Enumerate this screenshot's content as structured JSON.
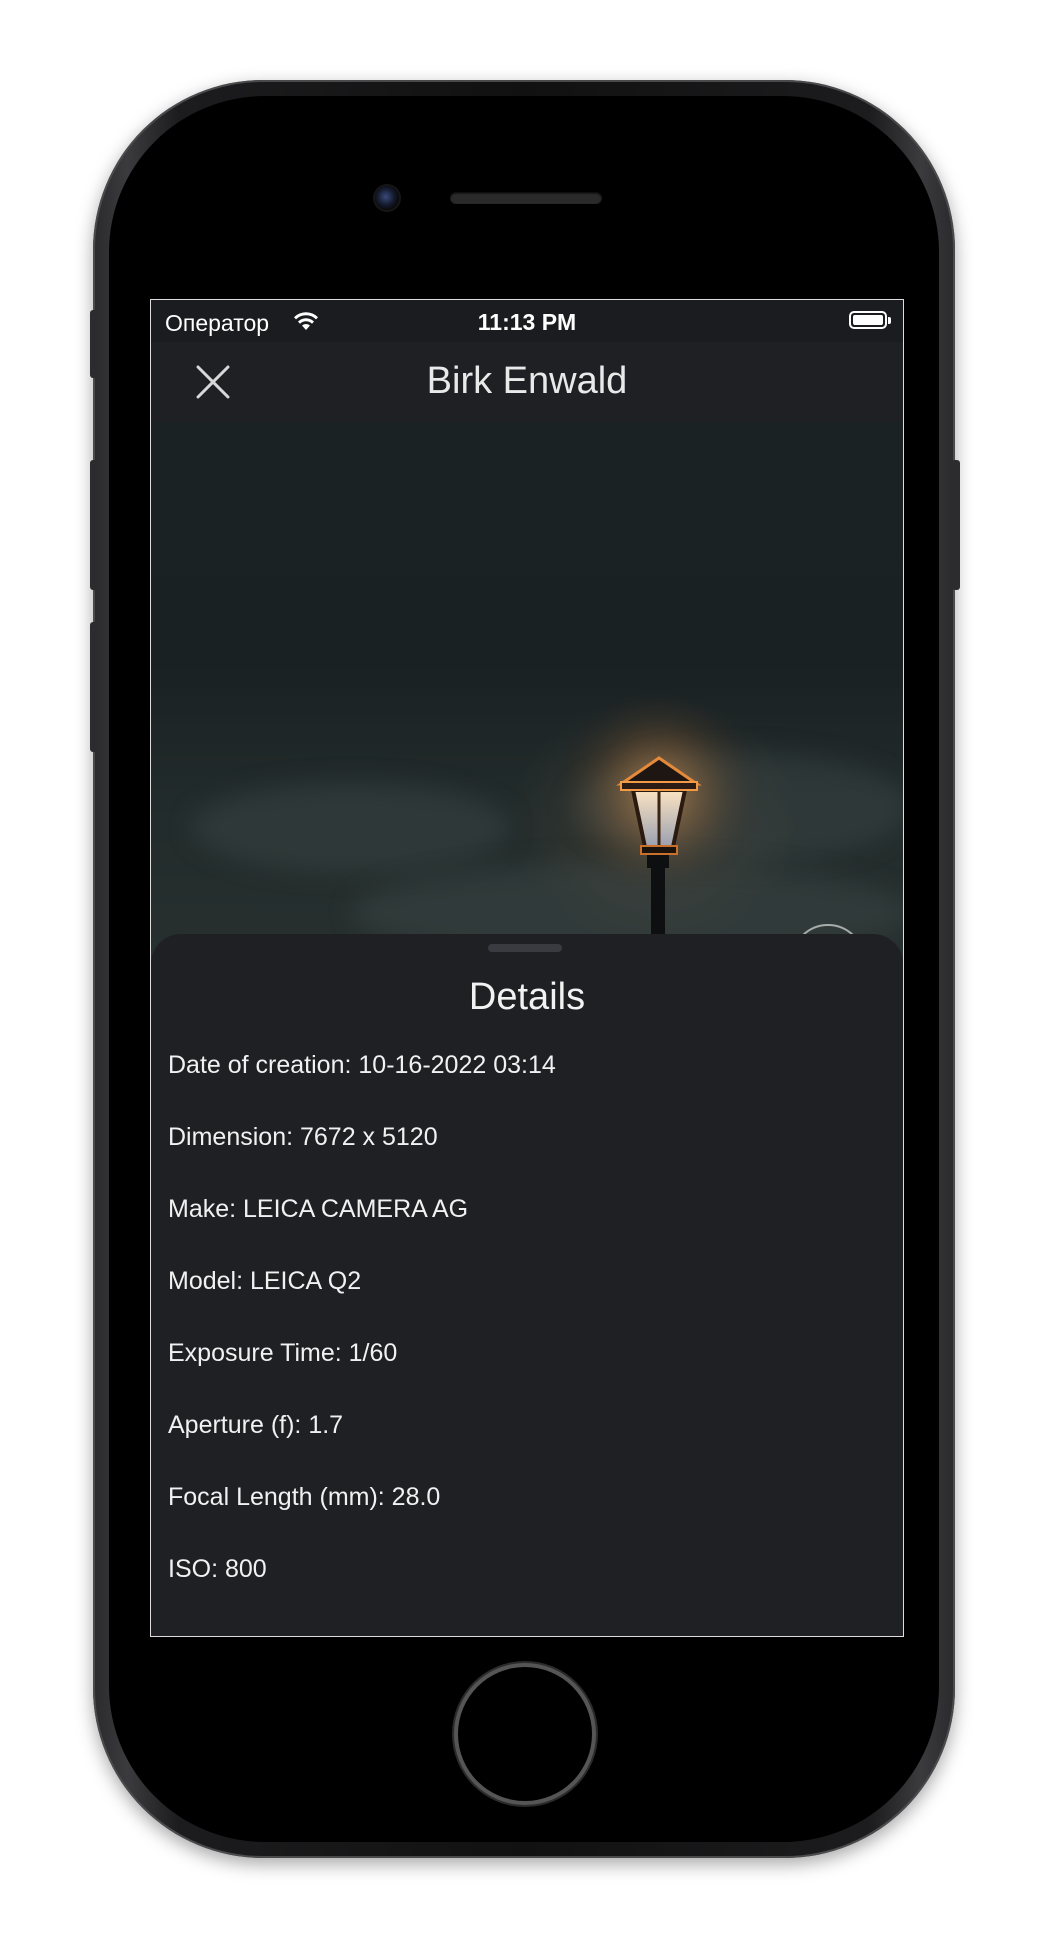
{
  "status_bar": {
    "carrier": "Оператор",
    "time": "11:13 PM"
  },
  "nav": {
    "title": "Birk Enwald",
    "close_icon": "close-icon"
  },
  "details": {
    "title": "Details",
    "rows": [
      "Date of creation: 10-16-2022 03:14",
      "Dimension: 7672 x 5120",
      "Make: LEICA CAMERA AG",
      "Model: LEICA Q2",
      "Exposure Time: 1/60",
      "Aperture (f): 1.7",
      "Focal Length (mm): 28.0",
      "ISO: 800"
    ]
  },
  "colors": {
    "background": "#1b1c20",
    "sheet": "#1f2024",
    "lamp_glow": "#f0a050"
  }
}
